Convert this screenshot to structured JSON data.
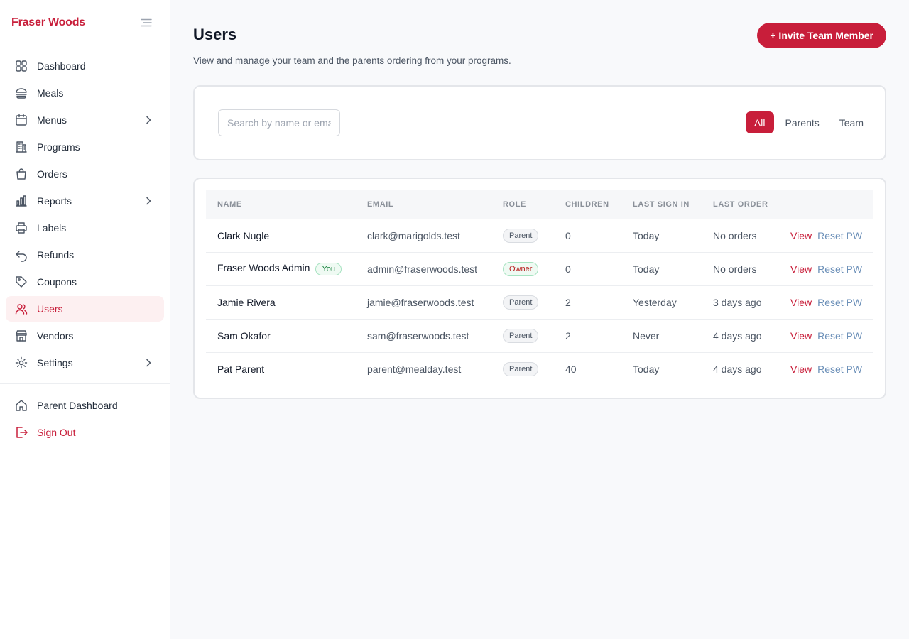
{
  "brand": {
    "name": "Fraser Woods",
    "accent": "#c81e3a"
  },
  "sidebar": {
    "items": [
      {
        "label": "Dashboard",
        "icon": "grid-icon",
        "chevron": false,
        "active": false
      },
      {
        "label": "Meals",
        "icon": "burger-icon",
        "chevron": false,
        "active": false
      },
      {
        "label": "Menus",
        "icon": "calendar-icon",
        "chevron": true,
        "active": false
      },
      {
        "label": "Programs",
        "icon": "building-icon",
        "chevron": false,
        "active": false
      },
      {
        "label": "Orders",
        "icon": "bag-icon",
        "chevron": false,
        "active": false
      },
      {
        "label": "Reports",
        "icon": "bar-chart-icon",
        "chevron": true,
        "active": false
      },
      {
        "label": "Labels",
        "icon": "printer-icon",
        "chevron": false,
        "active": false
      },
      {
        "label": "Refunds",
        "icon": "undo-icon",
        "chevron": false,
        "active": false
      },
      {
        "label": "Coupons",
        "icon": "tag-icon",
        "chevron": false,
        "active": false
      },
      {
        "label": "Users",
        "icon": "users-icon",
        "chevron": false,
        "active": true
      },
      {
        "label": "Vendors",
        "icon": "store-icon",
        "chevron": false,
        "active": false
      },
      {
        "label": "Settings",
        "icon": "gear-icon",
        "chevron": true,
        "active": false
      }
    ],
    "bottom": {
      "parent_dashboard": "Parent Dashboard",
      "sign_out": "Sign Out"
    }
  },
  "header": {
    "title": "Users",
    "subtitle": "View and manage your team and the parents ordering from your programs.",
    "invite_label": "+ Invite Team Member"
  },
  "filters": {
    "search_placeholder": "Search by name or email",
    "search_value": "",
    "segments": [
      "All",
      "Parents",
      "Team"
    ],
    "active_segment": "All"
  },
  "table": {
    "columns": [
      "NAME",
      "EMAIL",
      "ROLE",
      "CHILDREN",
      "LAST SIGN IN",
      "LAST ORDER"
    ],
    "rows": [
      {
        "name": "Clark Nugle",
        "you": "",
        "email": "clark@marigolds.test",
        "role": "Parent",
        "children": "0",
        "last_sign_in": "Today",
        "last_order": "No orders"
      },
      {
        "name": "Fraser Woods Admin",
        "you": "You",
        "email": "admin@fraserwoods.test",
        "role": "Owner",
        "children": "0",
        "last_sign_in": "Today",
        "last_order": "No orders"
      },
      {
        "name": "Jamie Rivera",
        "you": "",
        "email": "jamie@fraserwoods.test",
        "role": "Parent",
        "children": "2",
        "last_sign_in": "Yesterday",
        "last_order": "3 days ago"
      },
      {
        "name": "Sam Okafor",
        "you": "",
        "email": "sam@fraserwoods.test",
        "role": "Parent",
        "children": "2",
        "last_sign_in": "Never",
        "last_order": "4 days ago"
      },
      {
        "name": "Pat Parent",
        "you": "",
        "email": "parent@mealday.test",
        "role": "Parent",
        "children": "40",
        "last_sign_in": "Today",
        "last_order": "4 days ago"
      }
    ],
    "actions": {
      "view": "View",
      "reset": "Reset PW"
    }
  }
}
